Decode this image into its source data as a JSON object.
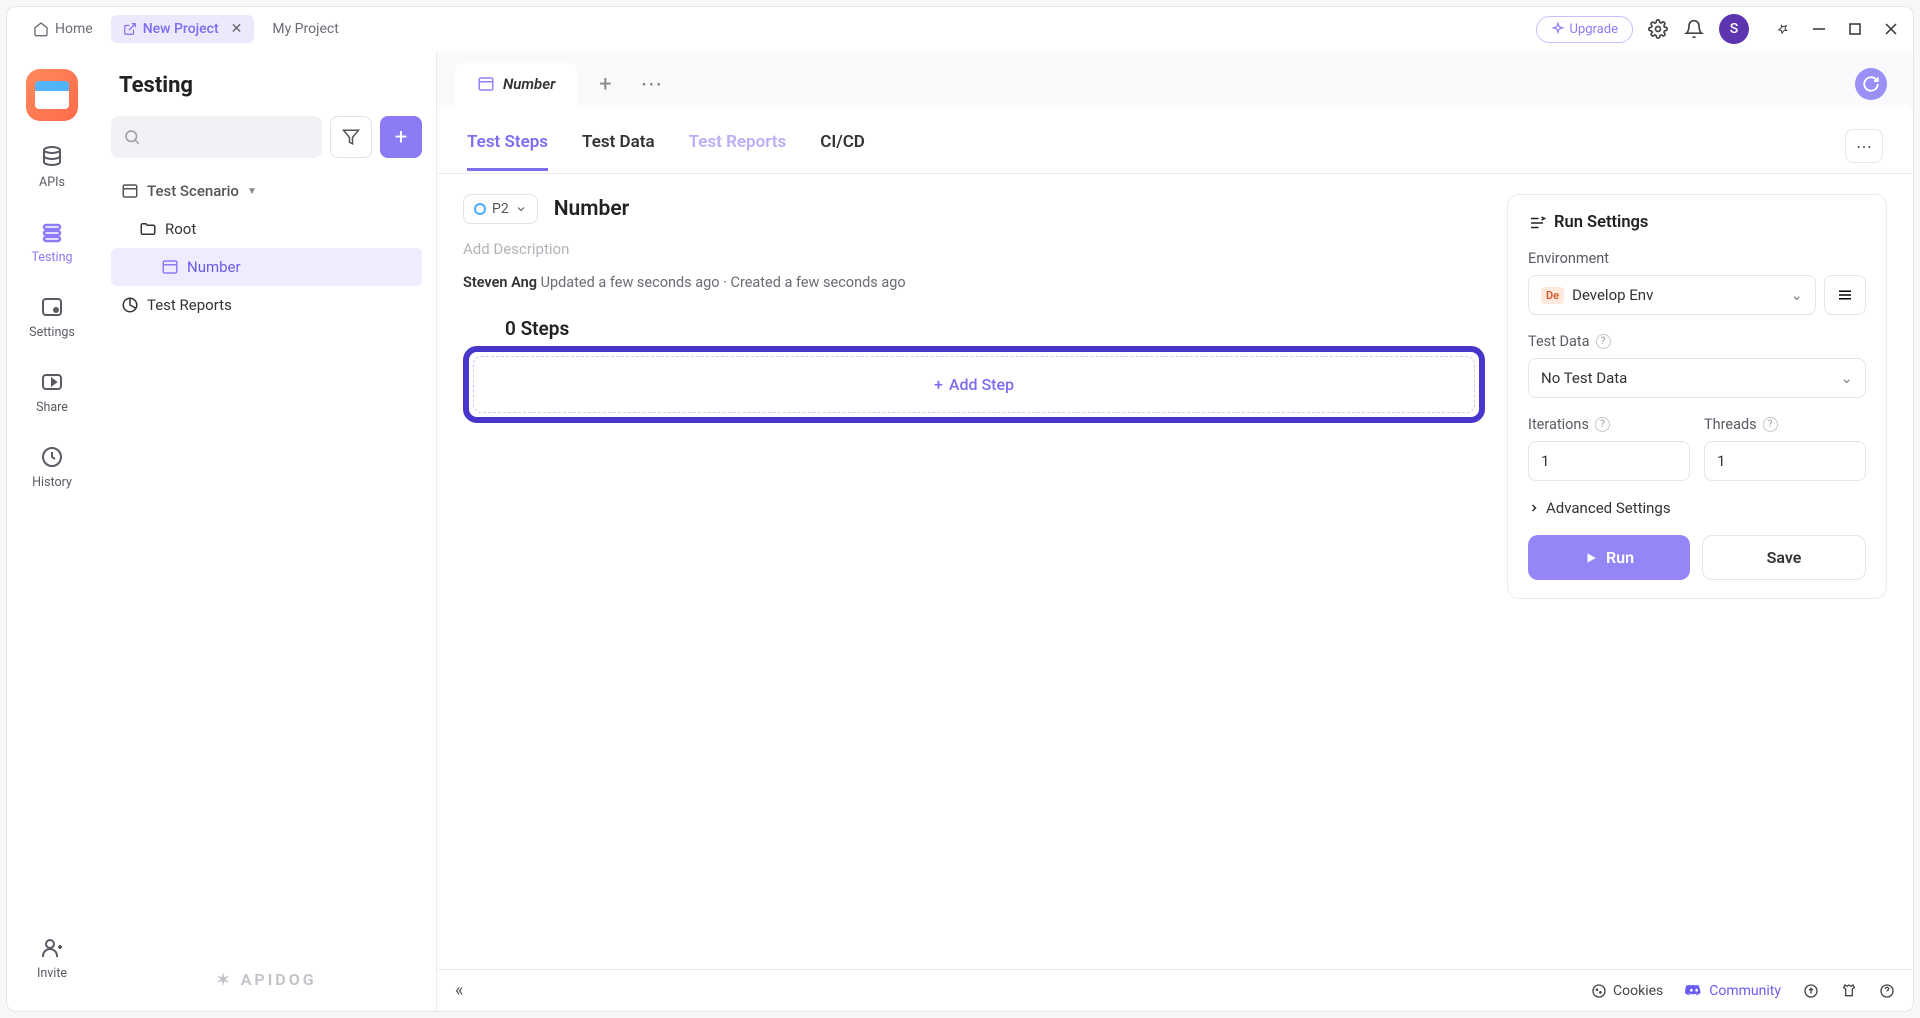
{
  "titlebar": {
    "home": "Home",
    "new_project": "New Project",
    "my_project": "My Project",
    "upgrade": "Upgrade",
    "avatar_initial": "S"
  },
  "rail": {
    "apis": "APIs",
    "testing": "Testing",
    "settings": "Settings",
    "share": "Share",
    "history": "History",
    "invite": "Invite"
  },
  "sidebar": {
    "title": "Testing",
    "tree_header": "Test Scenario",
    "root": "Root",
    "item_number": "Number",
    "test_reports": "Test Reports",
    "footer_brand": "APIDOG"
  },
  "doc_tab": {
    "label": "Number"
  },
  "inner_tabs": {
    "steps": "Test Steps",
    "data": "Test Data",
    "reports": "Test Reports",
    "cicd": "CI/CD"
  },
  "detail": {
    "priority": "P2",
    "title": "Number",
    "desc_placeholder": "Add Description",
    "author": "Steven Ang",
    "meta": "Updated a few seconds ago · Created a few seconds ago",
    "steps_count": "0 Steps",
    "add_step": "Add Step"
  },
  "run": {
    "title": "Run Settings",
    "env_label": "Environment",
    "env_badge": "De",
    "env_value": "Develop Env",
    "testdata_label": "Test Data",
    "testdata_value": "No Test Data",
    "iterations_label": "Iterations",
    "iterations_value": "1",
    "threads_label": "Threads",
    "threads_value": "1",
    "advanced": "Advanced Settings",
    "run_btn": "Run",
    "save_btn": "Save"
  },
  "bottom": {
    "cookies": "Cookies",
    "community": "Community"
  }
}
